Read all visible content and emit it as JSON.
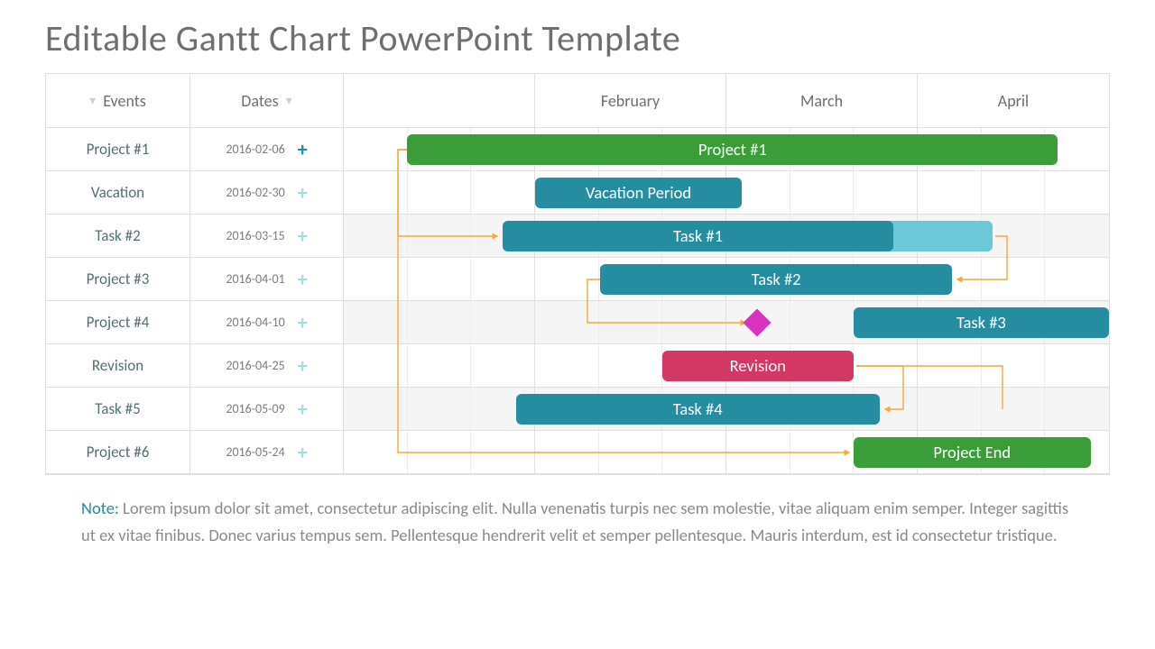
{
  "title": "Editable Gantt Chart PowerPoint Template",
  "headers": {
    "events": "Events",
    "dates": "Dates"
  },
  "months": [
    "",
    "February",
    "March",
    "April"
  ],
  "rows": [
    {
      "event": "Project #1",
      "date": "2016-02-06",
      "plus": "active"
    },
    {
      "event": "Vacation",
      "date": "2016-02-30",
      "plus": "dim"
    },
    {
      "event": "Task #2",
      "date": "2016-03-15",
      "plus": "dim"
    },
    {
      "event": "Project #3",
      "date": "2016-04-01",
      "plus": "dim"
    },
    {
      "event": "Project #4",
      "date": "2016-04-10",
      "plus": "dim"
    },
    {
      "event": "Revision",
      "date": "2016-04-25",
      "plus": "dim"
    },
    {
      "event": "Task #5",
      "date": "2016-05-09",
      "plus": "dim"
    },
    {
      "event": "Project #6",
      "date": "2016-05-24",
      "plus": "dim"
    }
  ],
  "bars": {
    "project1": "Project #1",
    "vacation": "Vacation Period",
    "task1": "Task #1",
    "task2": "Task #2",
    "task3": "Task #3",
    "revision": "Revision",
    "task4": "Task #4",
    "end": "Project End"
  },
  "note_label": "Note:",
  "note_text": " Lorem ipsum dolor sit amet, consectetur adipiscing elit. Nulla venenatis turpis nec sem molestie, vitae aliquam enim semper. Integer sagittis ut ex vitae finibus. Donec varius tempus sem. Pellentesque hendrerit velit et semper pellentesque. Mauris interdum, est id consectetur tristique.",
  "chart_data": {
    "type": "gantt",
    "title": "Editable Gantt Chart PowerPoint Template",
    "time_axis": {
      "columns": 12,
      "major_labels": [
        "",
        "February",
        "March",
        "April"
      ]
    },
    "tasks": [
      {
        "row": 0,
        "label": "Project #1",
        "start": 1.0,
        "end": 11.2,
        "color": "#3a9d3a"
      },
      {
        "row": 1,
        "label": "Vacation Period",
        "start": 3.0,
        "end": 6.2,
        "color": "#268c9f"
      },
      {
        "row": 2,
        "label": "Task #1",
        "start": 2.5,
        "end": 8.6,
        "color": "#268c9f",
        "progress_end": 10.2,
        "progress_color": "#6cc7d6"
      },
      {
        "row": 3,
        "label": "Task #2",
        "start": 4.0,
        "end": 9.5,
        "color": "#268c9f"
      },
      {
        "row": 4,
        "label": "Task #3",
        "start": 8.0,
        "end": 12.0,
        "color": "#268c9f"
      },
      {
        "row": 5,
        "label": "Revision",
        "start": 5.0,
        "end": 8.0,
        "color": "#d23864"
      },
      {
        "row": 6,
        "label": "Task #4",
        "start": 2.7,
        "end": 8.4,
        "color": "#268c9f"
      },
      {
        "row": 7,
        "label": "Project End",
        "start": 8.0,
        "end": 11.7,
        "color": "#3a9d3a"
      }
    ],
    "milestones": [
      {
        "row": 4,
        "at": 6.5,
        "color": "#d733bf"
      }
    ],
    "row_events": [
      {
        "event": "Project #1",
        "date": "2016-02-06"
      },
      {
        "event": "Vacation",
        "date": "2016-02-30"
      },
      {
        "event": "Task #2",
        "date": "2016-03-15"
      },
      {
        "event": "Project #3",
        "date": "2016-04-01"
      },
      {
        "event": "Project #4",
        "date": "2016-04-10"
      },
      {
        "event": "Revision",
        "date": "2016-04-25"
      },
      {
        "event": "Task #5",
        "date": "2016-05-09"
      },
      {
        "event": "Project #6",
        "date": "2016-05-24"
      }
    ]
  }
}
